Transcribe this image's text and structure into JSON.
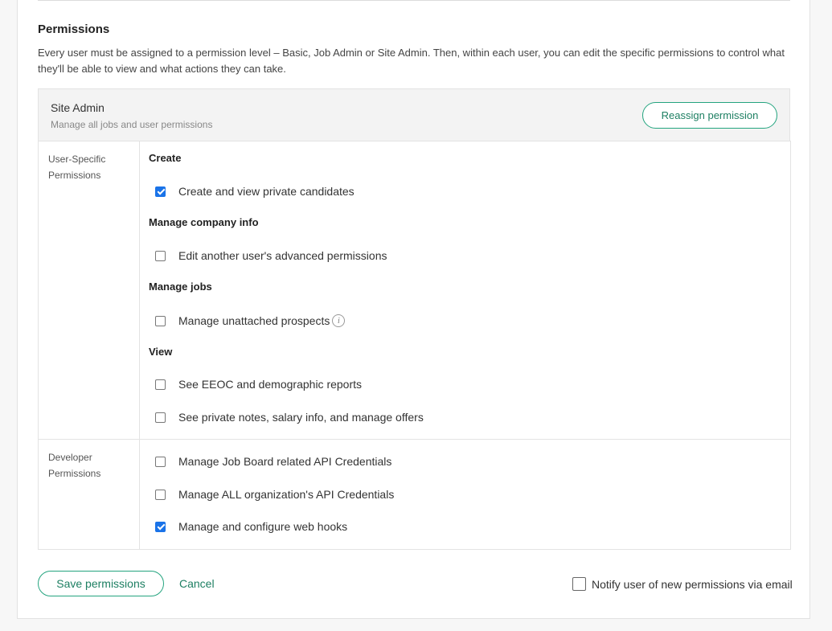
{
  "section": {
    "title": "Permissions",
    "description": "Every user must be assigned to a permission level – Basic, Job Admin or Site Admin. Then, within each user, you can edit the specific permissions to control what they'll be able to view and what actions they can take."
  },
  "level": {
    "name": "Site Admin",
    "description": "Manage all jobs and user permissions",
    "reassign_label": "Reassign permission"
  },
  "user_specific": {
    "label_line1": "User-Specific",
    "label_line2": "Permissions",
    "groups": [
      {
        "title": "Create",
        "items": [
          {
            "label": "Create and view private candidates",
            "checked": true
          }
        ]
      },
      {
        "title": "Manage company info",
        "items": [
          {
            "label": "Edit another user's advanced permissions",
            "checked": false
          }
        ]
      },
      {
        "title": "Manage jobs",
        "items": [
          {
            "label": "Manage unattached prospects",
            "checked": false,
            "info_icon": "info-icon"
          }
        ]
      },
      {
        "title": "View",
        "items": [
          {
            "label": "See EEOC and demographic reports",
            "checked": false
          },
          {
            "label": "See private notes, salary info, and manage offers",
            "checked": false
          }
        ]
      }
    ]
  },
  "developer": {
    "label_line1": "Developer",
    "label_line2": "Permissions",
    "items": [
      {
        "label": "Manage Job Board related API Credentials",
        "checked": false
      },
      {
        "label": "Manage ALL organization's API Credentials",
        "checked": false
      },
      {
        "label": "Manage and configure web hooks",
        "checked": true
      }
    ]
  },
  "footer": {
    "save_label": "Save permissions",
    "cancel_label": "Cancel",
    "notify_label": "Notify user of new permissions via email",
    "notify_checked": false
  },
  "colors": {
    "accent": "#24a47f",
    "checkbox_checked": "#1a73e8"
  }
}
